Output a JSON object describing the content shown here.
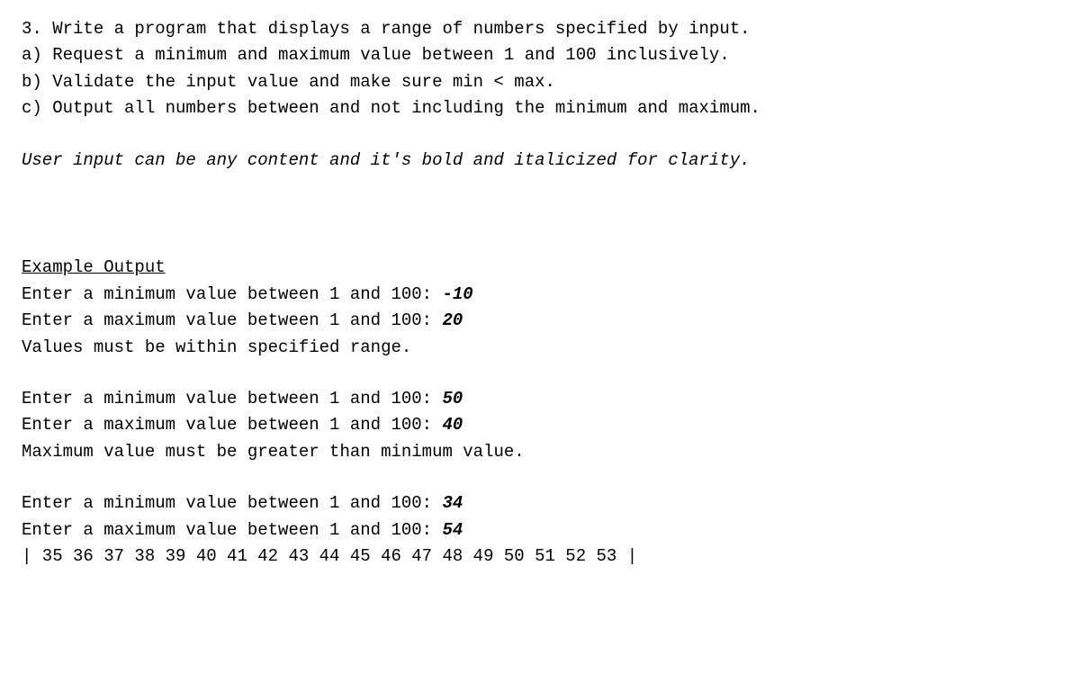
{
  "problem": {
    "title": "3. Write a program that displays a range of numbers specified by input.",
    "parts": {
      "a": "a) Request a minimum and maximum value between 1 and 100 inclusively.",
      "b": "b) Validate the input value and make sure min < max.",
      "c": "c) Output all numbers between and not including the minimum and maximum."
    },
    "note": "User input can be any content and it's bold and italicized for clarity."
  },
  "example": {
    "heading": "Example Output",
    "attempts": [
      {
        "min_prompt": "Enter a minimum value between 1 and 100: ",
        "min_input": "-10",
        "max_prompt": "Enter a maximum value between 1 and 100: ",
        "max_input": "20",
        "result": "Values must be within specified range."
      },
      {
        "min_prompt": "Enter a minimum value between 1 and 100: ",
        "min_input": "50",
        "max_prompt": "Enter a maximum value between 1 and 100: ",
        "max_input": "40",
        "result": "Maximum value must be greater than minimum value."
      },
      {
        "min_prompt": "Enter a minimum value between 1 and 100: ",
        "min_input": "34",
        "max_prompt": "Enter a maximum value between 1 and 100: ",
        "max_input": "54",
        "result": "| 35 36 37 38 39 40 41 42 43 44 45 46 47 48 49 50 51 52 53 |"
      }
    ]
  }
}
